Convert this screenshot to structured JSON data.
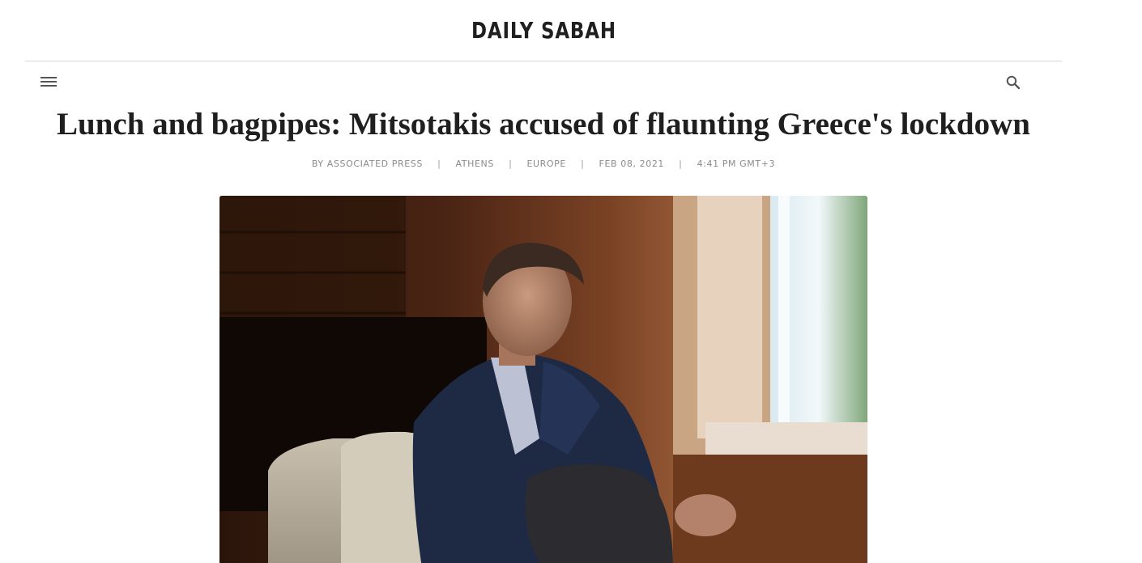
{
  "masthead": {
    "logo_text": "DAILY SABAH"
  },
  "nav": {
    "menu_icon": "hamburger-menu-icon",
    "search_icon": "search-icon"
  },
  "article": {
    "headline": "Lunch and bagpipes: Mitsotakis accused of flaunting Greece's lockdown",
    "meta": {
      "author": "BY ASSOCIATED PRESS",
      "location": "ATHENS",
      "category": "EUROPE",
      "date": "FEB 08, 2021",
      "time": "4:41 PM GMT+3",
      "separator": "|"
    }
  },
  "colors": {
    "text": "#1f1f1f",
    "meta": "#8a8a8a",
    "divider": "#d6d6d6"
  }
}
